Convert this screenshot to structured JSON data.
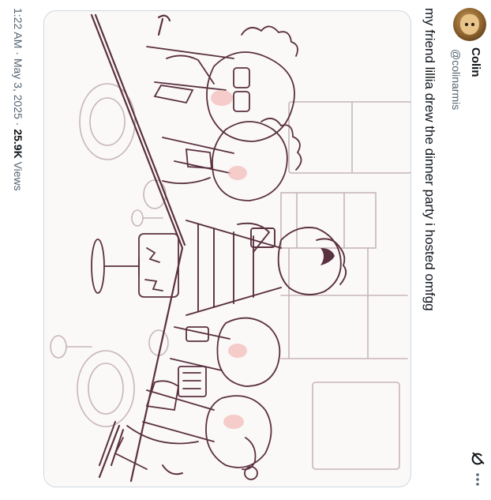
{
  "author": {
    "display_name": "Colin",
    "handle": "@colinarmis",
    "avatar_icon": "avatar-portrait"
  },
  "tweet": {
    "text": "my friend lillia drew the dinner party i hosted omfgg"
  },
  "meta": {
    "time": "1:22 AM",
    "separator1": " · ",
    "date": "May 3, 2025",
    "separator2": " · ",
    "views_count": "25.9K",
    "views_label": " Views"
  },
  "icons": {
    "grok": "grok-icon",
    "more": "more-icon"
  },
  "colors": {
    "sketch_line": "#5a3140",
    "sketch_light": "#c7b6ba",
    "skin_blush": "#f2b9b6",
    "text_primary": "#0f1419",
    "text_secondary": "#536471",
    "border": "#cfd9de"
  }
}
